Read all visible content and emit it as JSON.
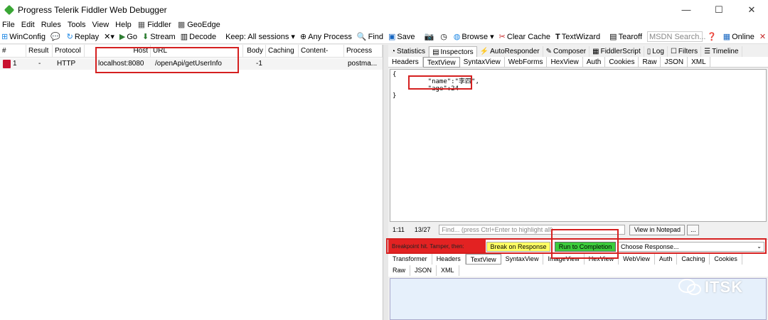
{
  "window": {
    "title": "Progress Telerik Fiddler Web Debugger",
    "minimize": "—",
    "maximize": "☐",
    "close": "✕"
  },
  "menu": [
    {
      "label": "File"
    },
    {
      "label": "Edit"
    },
    {
      "label": "Rules"
    },
    {
      "label": "Tools"
    },
    {
      "label": "View"
    },
    {
      "label": "Help"
    },
    {
      "label": "Fiddler",
      "icon": "fiddler-icon"
    },
    {
      "label": "GeoEdge",
      "icon": "geoedge-icon"
    }
  ],
  "toolbar": {
    "winconfig": "WinConfig",
    "replay": "Replay",
    "remove": "✕▾",
    "go": "Go",
    "stream": "Stream",
    "decode": "Decode",
    "keep": "Keep: All sessions ▾",
    "process": "Any Process",
    "find": "Find",
    "save": "Save",
    "browse": "Browse ▾",
    "clear_cache": "Clear Cache",
    "textwizard": "TextWizard",
    "tearoff": "Tearoff",
    "search_placeholder": "MSDN Search...",
    "online": "Online"
  },
  "sessions": {
    "columns": [
      "#",
      "Result",
      "Protocol",
      "Host",
      "URL",
      "Body",
      "Caching",
      "Content-Type",
      "Process"
    ],
    "rows": [
      {
        "num": "1",
        "result": "-",
        "protocol": "HTTP",
        "host": "localhost:8080",
        "url": "/openApi/getUserInfo",
        "body": "-1",
        "caching": "",
        "content_type": "",
        "process": "postma..."
      }
    ]
  },
  "inspectors": {
    "tabs": [
      {
        "label": "Statistics",
        "icon": "statistics-icon"
      },
      {
        "label": "Inspectors",
        "icon": "inspectors-icon",
        "active": true
      },
      {
        "label": "AutoResponder",
        "icon": "autoresponder-icon"
      },
      {
        "label": "Composer",
        "icon": "composer-icon"
      },
      {
        "label": "FiddlerScript",
        "icon": "fiddlerscript-icon"
      },
      {
        "label": "Log",
        "icon": "log-icon"
      },
      {
        "label": "Filters",
        "icon": "filters-icon"
      },
      {
        "label": "Timeline",
        "icon": "timeline-icon"
      }
    ],
    "request_tabs": [
      {
        "label": "Headers"
      },
      {
        "label": "TextView",
        "active": true
      },
      {
        "label": "SyntaxView"
      },
      {
        "label": "WebForms"
      },
      {
        "label": "HexView"
      },
      {
        "label": "Auth"
      },
      {
        "label": "Cookies"
      },
      {
        "label": "Raw"
      },
      {
        "label": "JSON"
      },
      {
        "label": "XML"
      }
    ],
    "text_lines": [
      "{",
      "    \"name\":\"李四\",",
      "    \"age\":24",
      "}"
    ],
    "cursor_pos": "1:11",
    "char_count": "13/27",
    "find_placeholder": "Find... (press Ctrl+Enter to highlight all)",
    "view_notepad": "View in Notepad",
    "more": "..."
  },
  "breakpoint": {
    "label": "Breakpoint hit. Tamper, then:",
    "break_on_response": "Break on Response",
    "run_to_completion": "Run to Completion",
    "choose_response": "Choose Response...",
    "dropdown": "⌄"
  },
  "response_tabs": {
    "row1": [
      {
        "label": "Transformer"
      },
      {
        "label": "Headers"
      },
      {
        "label": "TextView",
        "active": true
      },
      {
        "label": "SyntaxView"
      },
      {
        "label": "ImageView"
      },
      {
        "label": "HexView"
      },
      {
        "label": "WebView"
      },
      {
        "label": "Auth"
      },
      {
        "label": "Caching"
      },
      {
        "label": "Cookies"
      }
    ],
    "row2": [
      {
        "label": "Raw"
      },
      {
        "label": "JSON"
      },
      {
        "label": "XML"
      }
    ]
  },
  "watermark": {
    "text": "ITSK"
  },
  "colors": {
    "annotation": "#d52020",
    "breakpoint_red": "#e32222",
    "break_yellow": "#ffff64",
    "run_green": "#3ccc3c"
  }
}
